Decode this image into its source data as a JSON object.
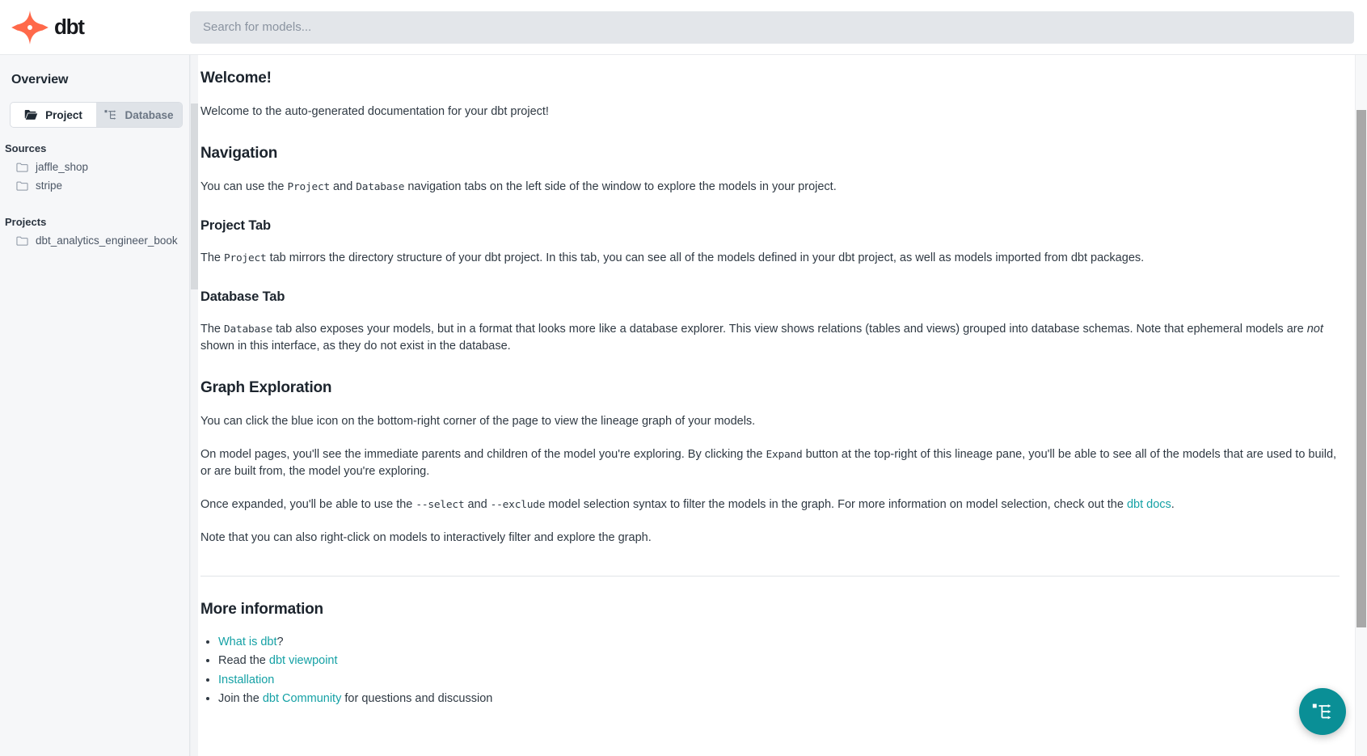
{
  "header": {
    "logo_alt": "dbt",
    "logo_wordmark": "dbt",
    "search": {
      "placeholder": "Search for models...",
      "value": ""
    }
  },
  "sidebar": {
    "title": "Overview",
    "tabs": [
      {
        "label": "Project",
        "icon": "folder-icon",
        "active": true
      },
      {
        "label": "Database",
        "icon": "lineage-icon",
        "active": false
      }
    ],
    "sections": [
      {
        "label": "Sources",
        "items": [
          {
            "label": "jaffle_shop",
            "icon": "folder-outline-icon"
          },
          {
            "label": "stripe",
            "icon": "folder-outline-icon"
          }
        ]
      },
      {
        "label": "Projects",
        "items": [
          {
            "label": "dbt_analytics_engineer_book",
            "icon": "folder-outline-icon"
          }
        ]
      }
    ]
  },
  "content": {
    "welcome_heading": "Welcome!",
    "welcome_paragraph": "Welcome to the auto-generated documentation for your dbt project!",
    "navigation_heading": "Navigation",
    "navigation_paragraph": {
      "part1": "You can use the ",
      "code1": "Project",
      "part2": " and ",
      "code2": "Database",
      "part3": " navigation tabs on the left side of the window to explore the models in your project."
    },
    "project_tab_heading": "Project Tab",
    "project_tab_paragraph": {
      "part1": "The ",
      "code1": "Project",
      "part2": " tab mirrors the directory structure of your dbt project. In this tab, you can see all of the models defined in your dbt project, as well as models imported from dbt packages."
    },
    "database_tab_heading": "Database Tab",
    "database_tab_paragraph": {
      "part1": "The ",
      "code1": "Database",
      "part2": " tab also exposes your models, but in a format that looks more like a database explorer. This view shows relations (tables and views) grouped into database schemas. Note that ephemeral models are ",
      "em1": "not",
      "part3": " shown in this interface, as they do not exist in the database."
    },
    "graph_heading": "Graph Exploration",
    "graph_paragraph1": "You can click the blue icon on the bottom-right corner of the page to view the lineage graph of your models.",
    "graph_paragraph2": {
      "part1": "On model pages, you'll see the immediate parents and children of the model you're exploring. By clicking the ",
      "code1": "Expand",
      "part2": " button at the top-right of this lineage pane, you'll be able to see all of the models that are used to build, or are built from, the model you're exploring."
    },
    "graph_paragraph3": {
      "part1": "Once expanded, you'll be able to use the ",
      "code1": "--select",
      "part2": " and ",
      "code2": "--exclude",
      "part3": " model selection syntax to filter the models in the graph. For more information on model selection, check out the ",
      "link1": "dbt docs",
      "part4": "."
    },
    "graph_paragraph4": "Note that you can also right-click on models to interactively filter and explore the graph.",
    "more_info_heading": "More information",
    "more_info_items": [
      {
        "pre": "",
        "link": "What is dbt",
        "post": "?"
      },
      {
        "pre": "Read the ",
        "link": "dbt viewpoint",
        "post": ""
      },
      {
        "pre": "",
        "link": "Installation",
        "post": ""
      },
      {
        "pre": "Join the ",
        "link": "dbt Community",
        "post": " for questions and discussion"
      }
    ]
  },
  "fab": {
    "label": "lineage-graph-button",
    "icon": "lineage-icon",
    "color": "#0a8f96"
  },
  "colors": {
    "link": "#15a1a5",
    "brand_red": "#ff694a",
    "sidebar_bg": "#f6f7f9",
    "search_bg": "#e3e6ea"
  }
}
